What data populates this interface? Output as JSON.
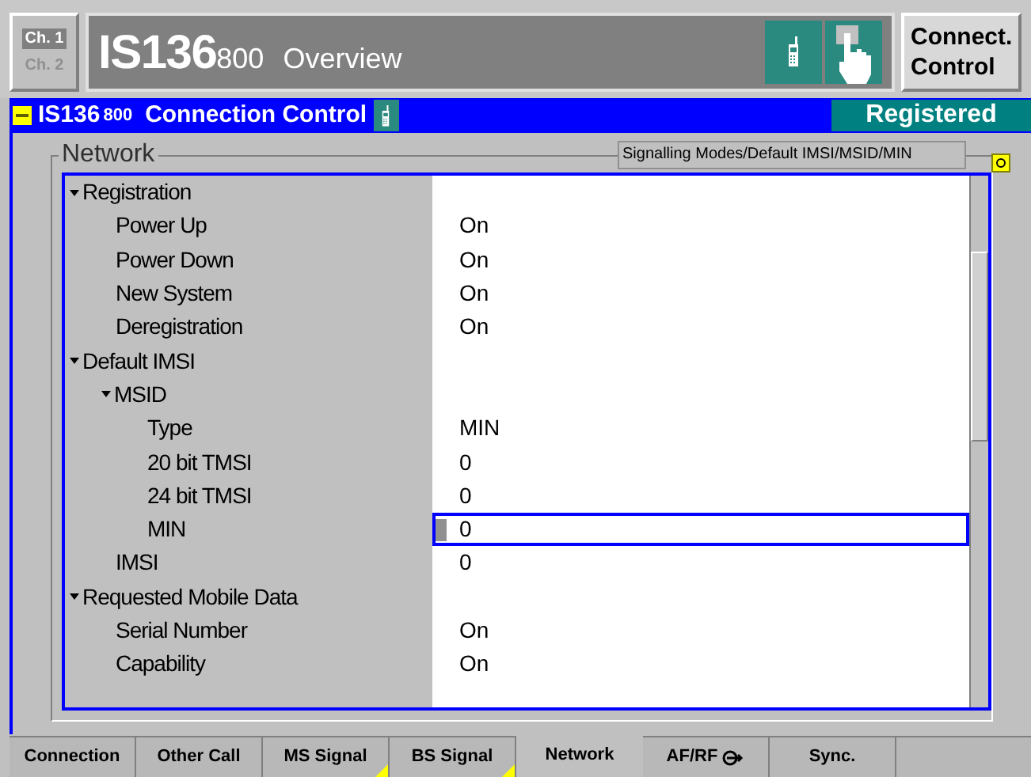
{
  "channels": [
    {
      "label": "Ch. 1",
      "selected": true
    },
    {
      "label": "Ch. 2",
      "selected": false
    }
  ],
  "header": {
    "title": "IS136",
    "title_suffix": "800",
    "subtitle": "Overview"
  },
  "side_button": {
    "label": "Connect. Control"
  },
  "title_bar": {
    "title": "IS136",
    "title_suffix": "800",
    "subtitle": "Connection Control",
    "status": "Registered"
  },
  "group": {
    "title": "Network",
    "path": "Signalling Modes/Default IMSI/MSID/MIN"
  },
  "tree": [
    {
      "label": "Registration",
      "expanded": true,
      "selected": false,
      "children": [
        {
          "label": "Power Up",
          "value": "On",
          "selected": false
        },
        {
          "label": "Power Down",
          "value": "On",
          "selected": false
        },
        {
          "label": "New System",
          "value": "On",
          "selected": false
        },
        {
          "label": "Deregistration",
          "value": "On",
          "selected": false
        }
      ]
    },
    {
      "label": "Default IMSI",
      "expanded": true,
      "selected": false,
      "children": [
        {
          "label": "MSID",
          "expanded": true,
          "selected": false,
          "children": [
            {
              "label": "Type",
              "value": "MIN",
              "selected": false
            },
            {
              "label": "20 bit TMSI",
              "value": "0",
              "selected": false
            },
            {
              "label": "24 bit TMSI",
              "value": "0",
              "selected": false
            },
            {
              "label": "MIN",
              "value": "0",
              "selected": true
            }
          ]
        },
        {
          "label": "IMSI",
          "value": "0",
          "selected": false
        }
      ]
    },
    {
      "label": "Requested Mobile Data",
      "expanded": true,
      "selected": false,
      "children": [
        {
          "label": "Serial Number",
          "value": "On",
          "selected": false
        },
        {
          "label": "Capability",
          "value": "On",
          "selected": false
        }
      ]
    }
  ],
  "tabs": [
    {
      "label": "Connection",
      "selected": false,
      "flag": false,
      "icon": false
    },
    {
      "label": "Other Call",
      "selected": false,
      "flag": false,
      "icon": false
    },
    {
      "label": "MS Signal",
      "selected": false,
      "flag": true,
      "icon": false
    },
    {
      "label": "BS Signal",
      "selected": false,
      "flag": true,
      "icon": false
    },
    {
      "label": "Network",
      "selected": true,
      "flag": false,
      "icon": false
    },
    {
      "label": "AF/RF",
      "selected": false,
      "flag": false,
      "icon": true
    },
    {
      "label": "Sync.",
      "selected": false,
      "flag": false,
      "icon": false
    }
  ]
}
